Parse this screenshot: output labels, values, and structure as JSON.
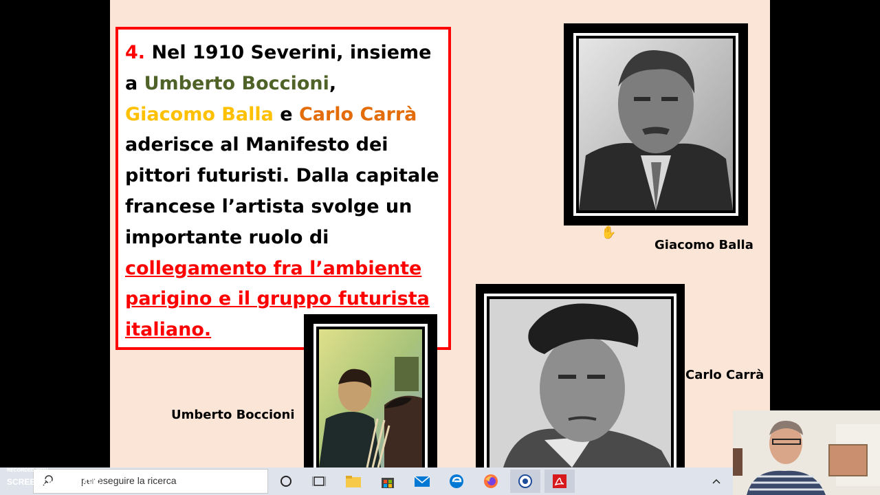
{
  "slide": {
    "text": {
      "number": "4.",
      "l1": " Nel 1910 Severini, insieme",
      "l2a": "a ",
      "boccioni": "Umberto Boccioni",
      "l2b": ",",
      "balla": "Giacomo Balla",
      "e": " e ",
      "carra": "Carlo Carrà",
      "l4": "aderisce al Manifesto dei",
      "l5": "pittori futuristi. Dalla capitale",
      "l6": "francese l’artista svolge un",
      "l7": "importante ruolo di",
      "link1": "collegamento fra l’ambiente",
      "link2": "parigino e il gruppo futurista",
      "link3": "italiano."
    },
    "captions": {
      "balla": "Giacomo Balla",
      "carra": "Carlo Carrà",
      "boccioni": "Umberto Boccioni"
    }
  },
  "taskbar": {
    "search_placeholder": "per eseguire la ricerca",
    "watermark_small": "RECORDED WITH",
    "watermark": "SCREENCAST-O-MATIC"
  },
  "colors": {
    "slide_bg": "#fbe5d6",
    "accent_red": "#ff0000",
    "boccioni_green": "#4f6228",
    "balla_yellow": "#ffc000",
    "carra_orange": "#e36c09"
  },
  "icons": [
    "search-icon",
    "cortana-icon",
    "task-view-icon",
    "file-explorer-icon",
    "store-icon",
    "mail-icon",
    "edge-icon",
    "firefox-icon",
    "media-icon",
    "acrobat-icon",
    "chevron-up-icon"
  ]
}
